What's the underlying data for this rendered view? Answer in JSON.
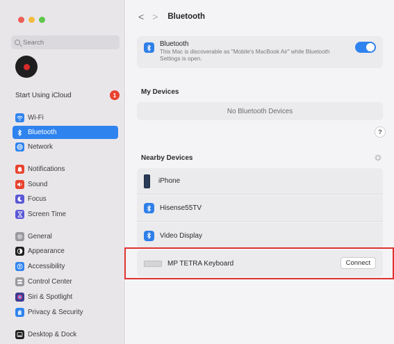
{
  "sidebar": {
    "search_placeholder": "Search",
    "icloud_label": "Start Using iCloud",
    "icloud_badge": "1",
    "items": [
      {
        "label": "Wi-Fi",
        "icon": "wifi-icon",
        "color": "#2f83ee"
      },
      {
        "label": "Bluetooth",
        "icon": "bluetooth-icon",
        "color": "#2f83ee",
        "active": true
      },
      {
        "label": "Network",
        "icon": "globe-icon",
        "color": "#2f83ee"
      },
      {
        "label": "Notifications",
        "icon": "bell-icon",
        "color": "#e8432f"
      },
      {
        "label": "Sound",
        "icon": "speaker-icon",
        "color": "#e8432f"
      },
      {
        "label": "Focus",
        "icon": "moon-icon",
        "color": "#5a57d6"
      },
      {
        "label": "Screen Time",
        "icon": "hourglass-icon",
        "color": "#5a57d6"
      },
      {
        "label": "General",
        "icon": "gear-icon",
        "color": "#9a9a9e"
      },
      {
        "label": "Appearance",
        "icon": "appearance-icon",
        "color": "#1f1f1f"
      },
      {
        "label": "Accessibility",
        "icon": "accessibility-icon",
        "color": "#2f83ee"
      },
      {
        "label": "Control Center",
        "icon": "control-center-icon",
        "color": "#9a9a9e"
      },
      {
        "label": "Siri & Spotlight",
        "icon": "siri-icon",
        "color": "#3b3b8f"
      },
      {
        "label": "Privacy & Security",
        "icon": "hand-icon",
        "color": "#2f83ee"
      },
      {
        "label": "Desktop & Dock",
        "icon": "dock-icon",
        "color": "#1f1f1f"
      }
    ]
  },
  "header": {
    "back_glyph": "<",
    "forward_glyph": ">",
    "title": "Bluetooth"
  },
  "bluetooth": {
    "title": "Bluetooth",
    "description": "This Mac is discoverable as \"Mobile's MacBook Air\" while Bluetooth Settings is open.",
    "enabled": true
  },
  "my_devices": {
    "title": "My Devices",
    "empty_text": "No Bluetooth Devices"
  },
  "help_glyph": "?",
  "nearby": {
    "title": "Nearby Devices",
    "devices": [
      {
        "name": "iPhone",
        "icon": "iphone-icon"
      },
      {
        "name": "Hisense55TV",
        "icon": "bluetooth-icon"
      },
      {
        "name": "Video Display",
        "icon": "bluetooth-icon"
      },
      {
        "name": "MP TETRA Keyboard",
        "icon": "keyboard-icon",
        "action": "Connect"
      }
    ]
  },
  "colors": {
    "accent": "#2f83ee",
    "highlight": "#e0312f"
  }
}
